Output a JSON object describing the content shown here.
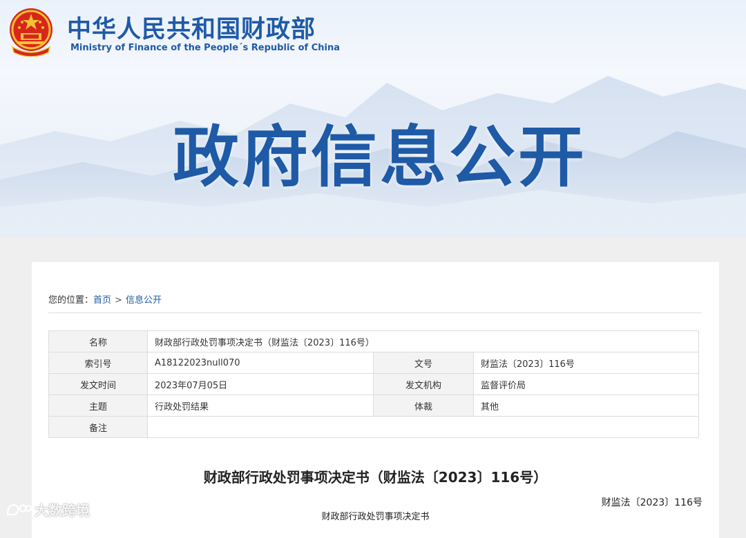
{
  "header": {
    "site_name_cn": "中华人民共和国财政部",
    "site_name_en": "Ministry of Finance of the People´s Republic of China",
    "emblem_icon": "national-emblem-icon",
    "hero_title": "政府信息公开"
  },
  "breadcrumb": {
    "prefix": "您的位置：",
    "home": "首页",
    "separator": ">",
    "current": "信息公开"
  },
  "meta": {
    "name_label": "名称",
    "name_value": "财政部行政处罚事项决定书（财监法〔2023〕116号）",
    "index_label": "索引号",
    "index_value": "A18122023null070",
    "doc_no_label": "文号",
    "doc_no_value": "财监法〔2023〕116号",
    "date_label": "发文时间",
    "date_value": "2023年07月05日",
    "issuer_label": "发文机构",
    "issuer_value": "监督评价局",
    "topic_label": "主题",
    "topic_value": "行政处罚结果",
    "genre_label": "体裁",
    "genre_value": "其他",
    "remark_label": "备注",
    "remark_value": ""
  },
  "document": {
    "title": "财政部行政处罚事项决定书（财监法〔2023〕116号）",
    "number": "财监法〔2023〕116号",
    "subtitle": "财政部行政处罚事项决定书"
  },
  "watermark": {
    "text": "大数跨境"
  },
  "colors": {
    "brand_blue": "#1f5aa6",
    "link_blue": "#1f5aa6",
    "label_bg": "#f3f3f3"
  }
}
